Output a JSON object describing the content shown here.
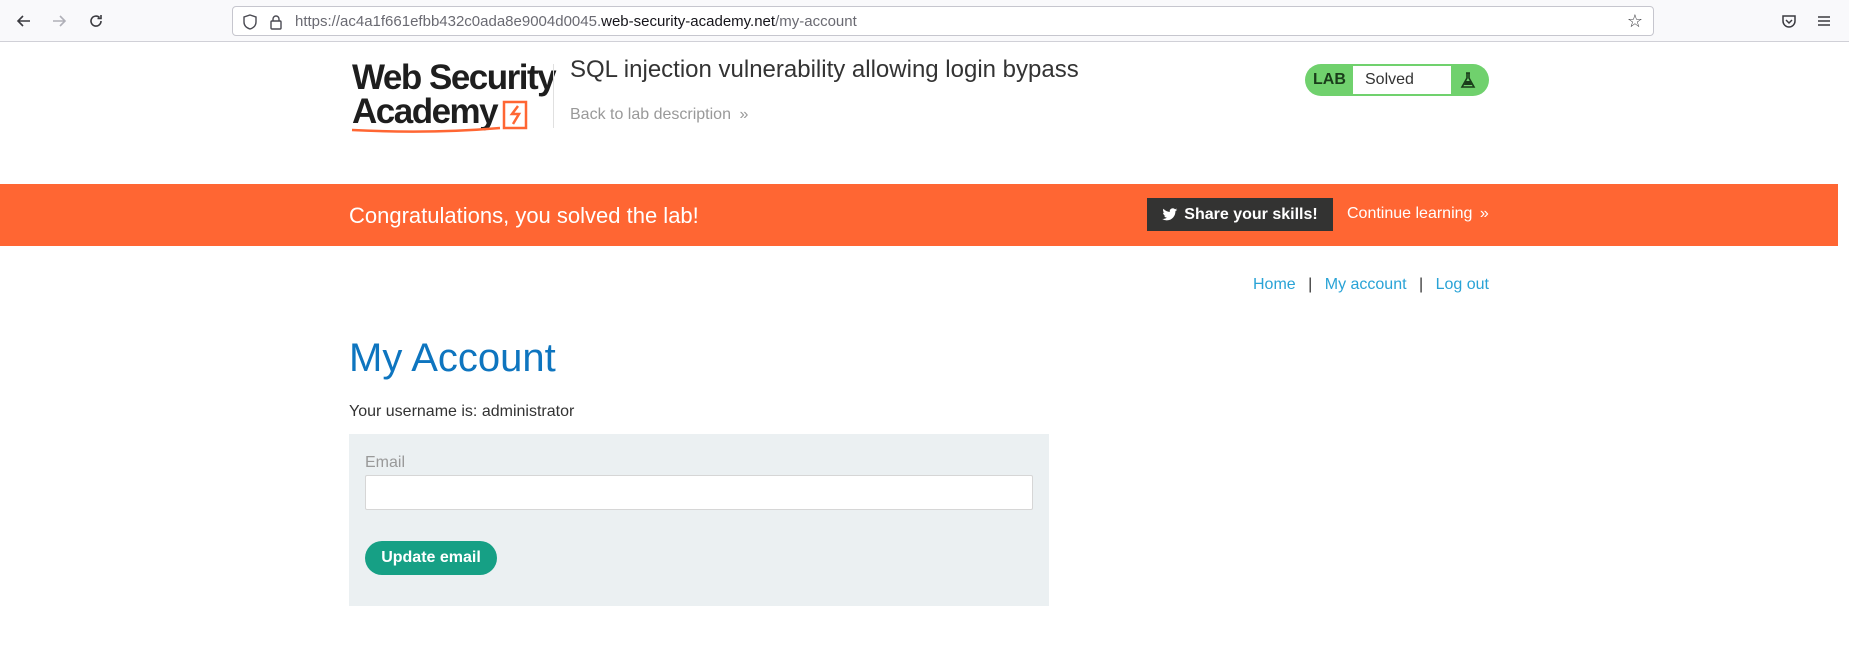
{
  "browser": {
    "url_prefix": "https://ac4a1f661efbb432c0ada8e9004d0045.",
    "url_domain": "web-security-academy.net",
    "url_path": "/my-account"
  },
  "header": {
    "logo_line1": "Web Security",
    "logo_line2": "Academy",
    "lab_title": "SQL injection vulnerability allowing login bypass",
    "back_link": "Back to lab description",
    "status_label": "LAB",
    "status_value": "Solved"
  },
  "banner": {
    "message": "Congratulations, you solved the lab!",
    "share_label": "Share your skills!",
    "continue_label": "Continue learning"
  },
  "nav": {
    "home": "Home",
    "my_account": "My account",
    "log_out": "Log out",
    "separator": "|"
  },
  "main": {
    "title": "My Account",
    "username_text": "Your username is: administrator",
    "email_label": "Email",
    "email_value": "",
    "update_label": "Update email"
  },
  "colors": {
    "accent_orange": "#ff6633",
    "title_blue": "#0e75bf",
    "link_blue": "#29a3d6",
    "status_green": "#70d16d",
    "button_teal": "#16a085"
  }
}
